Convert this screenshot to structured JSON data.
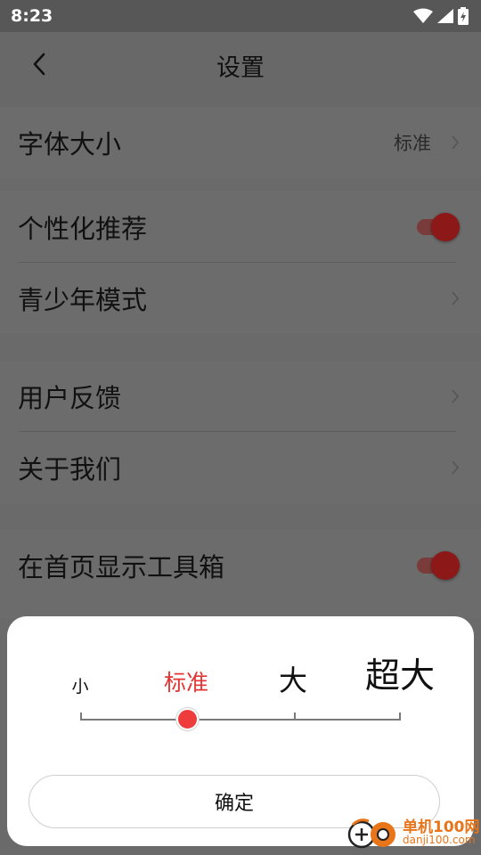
{
  "status_bar": {
    "time": "8:23",
    "icons": [
      "wifi-icon",
      "cell-signal-icon",
      "battery-charging-icon"
    ]
  },
  "header": {
    "title": "设置",
    "back_icon": "back-arrow-icon"
  },
  "settings": {
    "font_size": {
      "label": "字体大小",
      "value": "标准"
    },
    "personalized_recommendation": {
      "label": "个性化推荐",
      "enabled": true
    },
    "youth_mode": {
      "label": "青少年模式"
    },
    "feedback": {
      "label": "用户反馈"
    },
    "about_us": {
      "label": "关于我们"
    },
    "show_toolbox": {
      "label": "在首页显示工具箱",
      "enabled": true
    }
  },
  "font_sheet": {
    "options": [
      "小",
      "标准",
      "大",
      "超大"
    ],
    "selected_index": 1,
    "confirm_label": "确定"
  },
  "watermark": {
    "name": "单机100网",
    "url": "danji100.com"
  },
  "colors": {
    "accent": "#e33434",
    "toggle_dimmed": "#8c1818",
    "overlay": "#6a6a6a",
    "watermark": "#e8751a"
  }
}
